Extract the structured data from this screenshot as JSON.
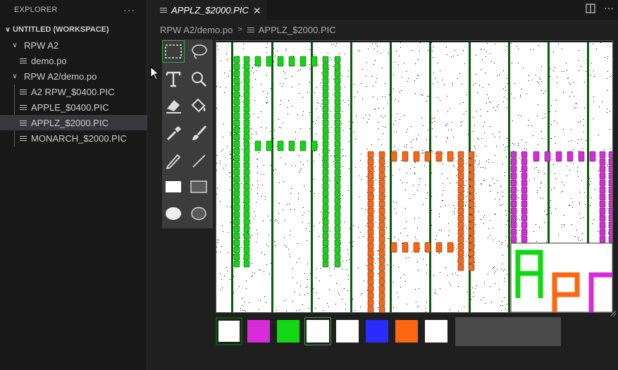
{
  "explorer": {
    "title": "EXPLORER",
    "more_label": "···",
    "workspace": "UNTITLED (WORKSPACE)",
    "tree": [
      {
        "label": "RPW A2",
        "type": "folder",
        "expanded": true
      },
      {
        "label": "demo.po",
        "type": "file"
      },
      {
        "label": "RPW A2/demo.po",
        "type": "folder",
        "expanded": true
      },
      {
        "label": "A2 RPW_$0400.PIC",
        "type": "file"
      },
      {
        "label": "APPLE_$0400.PIC",
        "type": "file"
      },
      {
        "label": "APPLZ_$2000.PIC",
        "type": "file",
        "selected": true
      },
      {
        "label": "MONARCH_$2000.PIC",
        "type": "file"
      }
    ]
  },
  "editor_tab": {
    "label": "APPLZ_$2000.PIC",
    "close_glyph": "✕"
  },
  "breadcrumb": [
    "RPW A2/demo.po",
    "APPLZ_$2000.PIC"
  ],
  "tools": [
    {
      "name": "rect-select-icon",
      "active": true
    },
    {
      "name": "lasso-icon"
    },
    {
      "name": "text-icon"
    },
    {
      "name": "zoom-icon"
    },
    {
      "name": "eraser-icon"
    },
    {
      "name": "fill-bucket-icon"
    },
    {
      "name": "eyedropper-icon"
    },
    {
      "name": "brush-icon"
    },
    {
      "name": "pencil-icon"
    },
    {
      "name": "line-icon"
    },
    {
      "name": "filled-rect-icon"
    },
    {
      "name": "outline-rect-icon"
    },
    {
      "name": "filled-ellipse-icon"
    },
    {
      "name": "outline-ellipse-icon"
    }
  ],
  "palette": [
    {
      "color": "#ffffff",
      "pattern": "white",
      "ring": "#0a5c0a"
    },
    {
      "color": "#d92bd9"
    },
    {
      "color": "#11d911"
    },
    {
      "color": "#ffffff",
      "selected": true
    },
    {
      "color": "#ffffff",
      "pattern": "white"
    },
    {
      "color": "#2b2bff"
    },
    {
      "color": "#ff6611"
    },
    {
      "color": "#ffffff"
    }
  ],
  "colors": {
    "green": "#11d911",
    "orange": "#ff6611",
    "magenta": "#d92bd9",
    "dark_green": "#0a5c0a",
    "accent": "#3aa63a"
  }
}
